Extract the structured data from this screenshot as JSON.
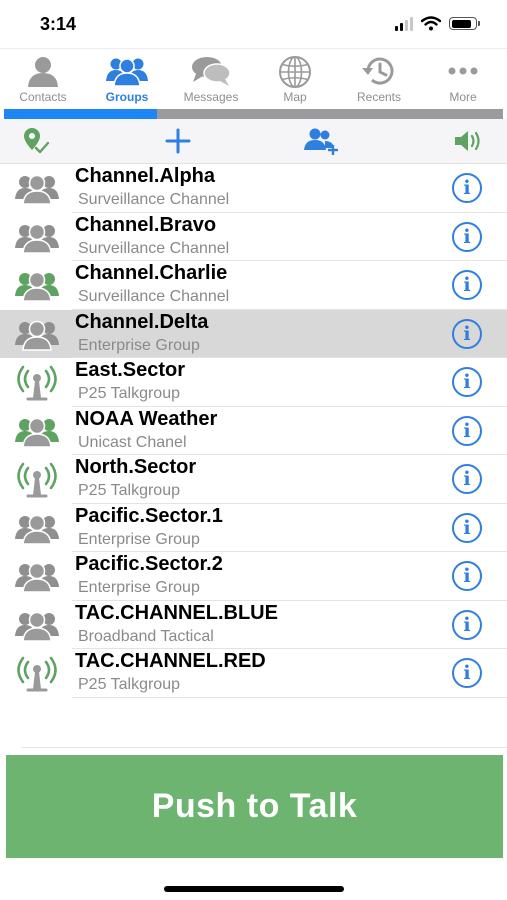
{
  "status_bar": {
    "time": "3:14"
  },
  "tabs": [
    {
      "label": "Contacts",
      "icon": "contact-icon",
      "active": false
    },
    {
      "label": "Groups",
      "icon": "groups-icon",
      "active": true
    },
    {
      "label": "Messages",
      "icon": "messages-icon",
      "active": false
    },
    {
      "label": "Map",
      "icon": "globe-icon",
      "active": false
    },
    {
      "label": "Recents",
      "icon": "recents-icon",
      "active": false
    },
    {
      "label": "More",
      "icon": "more-icon",
      "active": false
    }
  ],
  "toolbar": {
    "icons": [
      "map-pin-check-icon",
      "plus-icon",
      "add-users-icon",
      "speaker-icon"
    ]
  },
  "groups": [
    {
      "name": "Channel.Alpha",
      "type": "Surveillance Channel",
      "icon": "people-group-icon",
      "selected": false
    },
    {
      "name": "Channel.Bravo",
      "type": "Surveillance Channel",
      "icon": "people-group-icon",
      "selected": false
    },
    {
      "name": "Channel.Charlie",
      "type": "Surveillance Channel",
      "icon": "people-group-icon",
      "selected": false
    },
    {
      "name": "Channel.Delta",
      "type": "Enterprise Group",
      "icon": "people-group-icon",
      "selected": true
    },
    {
      "name": "East.Sector",
      "type": "P25 Talkgroup",
      "icon": "radio-tower-icon",
      "selected": false
    },
    {
      "name": "NOAA Weather",
      "type": "Unicast Chanel",
      "icon": "people-group-icon",
      "selected": false
    },
    {
      "name": "North.Sector",
      "type": "P25 Talkgroup",
      "icon": "radio-tower-icon",
      "selected": false
    },
    {
      "name": "Pacific.Sector.1",
      "type": "Enterprise Group",
      "icon": "people-group-icon",
      "selected": false
    },
    {
      "name": "Pacific.Sector.2",
      "type": "Enterprise Group",
      "icon": "people-group-icon",
      "selected": false
    },
    {
      "name": "TAC.CHANNEL.BLUE",
      "type": "Broadband Tactical",
      "icon": "people-group-icon",
      "selected": false
    },
    {
      "name": "TAC.CHANNEL.RED",
      "type": "P25 Talkgroup",
      "icon": "radio-tower-icon",
      "selected": false
    }
  ],
  "ptt": {
    "label": "Push to Talk"
  },
  "colors": {
    "accent_blue": "#1d86f4",
    "ptt_green": "#6cb46f",
    "icon_green": "#5ea361",
    "icon_gray": "#9a9a9a"
  }
}
